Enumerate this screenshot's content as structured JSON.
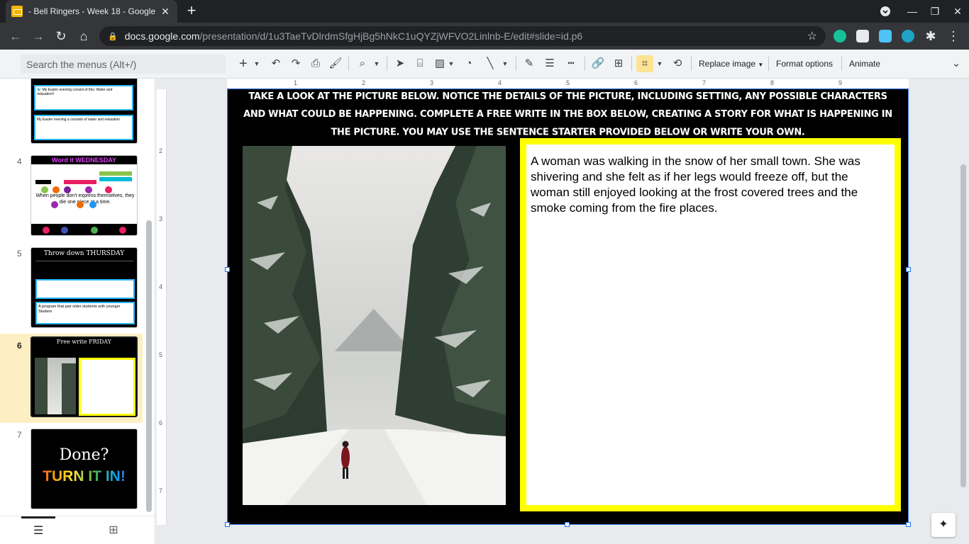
{
  "browser": {
    "tab_title": "- Bell Ringers - Week 18 - Google",
    "url_host": "docs.google.com",
    "url_path": "/presentation/d/1u3TaeTvDlrdmSfgHjBg5hNkC1uQYZjWFVO2Linlnb-E/edit#slide=id.p6"
  },
  "toolbar": {
    "search_placeholder": "Search the menus (Alt+/)",
    "replace_image": "Replace image",
    "format_options": "Format options",
    "animate": "Animate"
  },
  "filmstrip": {
    "slides": [
      {
        "number": "",
        "kind": "slide3"
      },
      {
        "number": "4",
        "title": "Word it WEDNESDAY",
        "sentence": "When people don't express themselves, they die one piece at a time."
      },
      {
        "number": "5",
        "title": "Throw down THURSDAY",
        "answer": "A program that pair older students with younger Student"
      },
      {
        "number": "6",
        "title": "Free write FRIDAY"
      },
      {
        "number": "7",
        "title_top": "Done?",
        "title_bottom": "TURN IT IN!"
      }
    ],
    "slide3_text1": "My Easter evening consist of this: Water and relaxation!!",
    "slide3_text2": "My Easter evening a consists of water and relaxation"
  },
  "rulers": {
    "h": [
      "1",
      "2",
      "3",
      "4",
      "5",
      "6",
      "7",
      "8",
      "9"
    ],
    "v": [
      "2",
      "3",
      "4",
      "5",
      "6",
      "7"
    ]
  },
  "slide": {
    "instructions": "TAKE A LOOK AT THE PICTURE BELOW. NOTICE THE DETAILS OF THE PICTURE, INCLUDING SETTING, ANY POSSIBLE CHARACTERS AND WHAT COULD BE HAPPENING. COMPLETE A FREE WRITE IN THE BOX BELOW, CREATING A STORY FOR WHAT IS HAPPENING IN THE PICTURE. YOU MAY USE THE SENTENCE STARTER PROVIDED BELOW OR WRITE YOUR OWN.",
    "story": "A woman was walking in the snow of her small town. She was shivering and she felt as if her legs would freeze off, but the woman still enjoyed looking at the frost covered trees and the smoke coming from the fire places."
  },
  "colors": {
    "highlight_yellow": "#ffff00",
    "selection_blue": "#1a73e8",
    "selected_slide_bg": "#feefc3"
  }
}
